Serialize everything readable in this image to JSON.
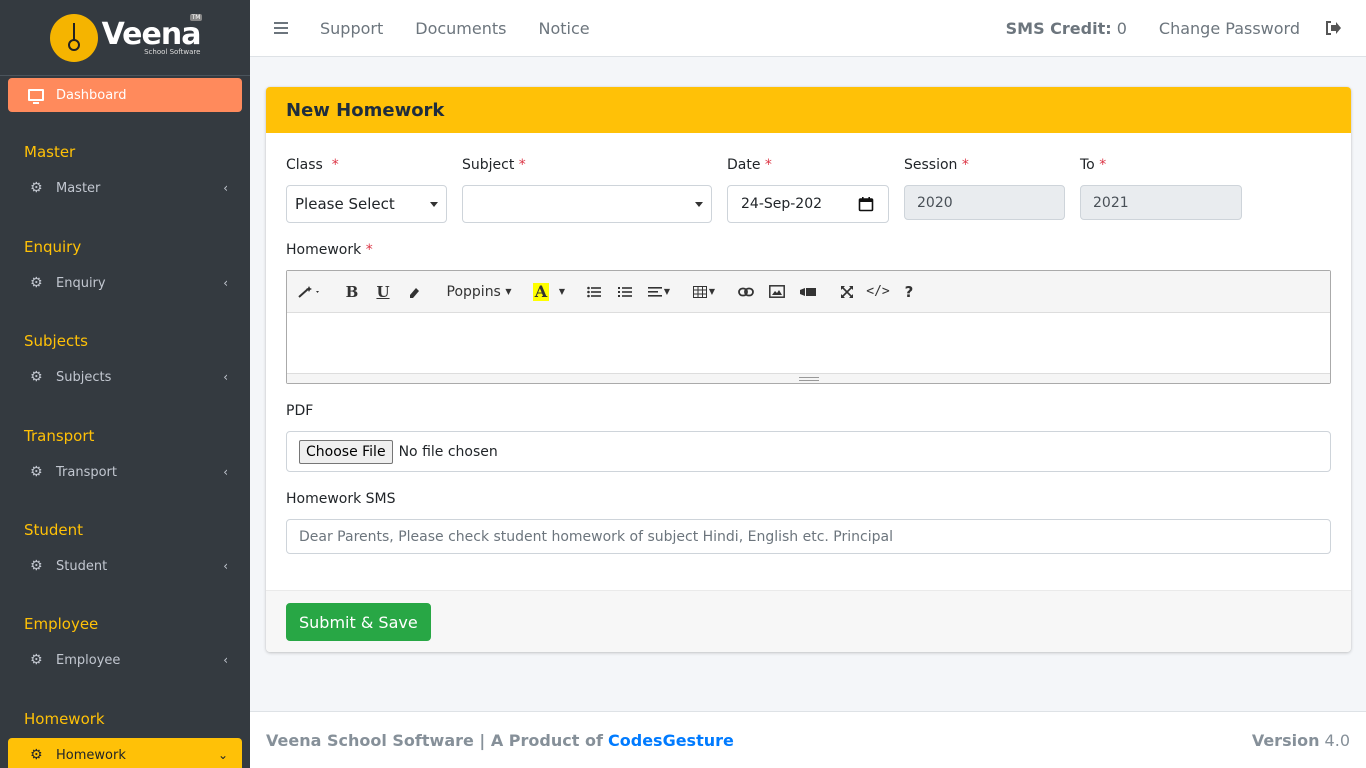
{
  "brand": {
    "name": "Veena",
    "subtitle": "School Software",
    "badge": "TM"
  },
  "sidebar": {
    "dashboard": "Dashboard",
    "sections": [
      {
        "header": "Master",
        "item": "Master"
      },
      {
        "header": "Enquiry",
        "item": "Enquiry"
      },
      {
        "header": "Subjects",
        "item": "Subjects"
      },
      {
        "header": "Transport",
        "item": "Transport"
      },
      {
        "header": "Student",
        "item": "Student"
      },
      {
        "header": "Employee",
        "item": "Employee"
      },
      {
        "header": "Homework",
        "item": "Homework"
      }
    ]
  },
  "topbar": {
    "links": [
      "Support",
      "Documents",
      "Notice"
    ],
    "sms_label": "SMS Credit:",
    "sms_value": "0",
    "change_password": "Change Password"
  },
  "form": {
    "title": "New Homework",
    "class_label": "Class",
    "class_value": "Please Select",
    "subject_label": "Subject",
    "subject_value": "",
    "date_label": "Date",
    "date_value": "24-Sep-202",
    "session_label": "Session",
    "session_value": "2020",
    "to_label": "To",
    "to_value": "2021",
    "required_mark": "*",
    "homework_label": "Homework",
    "editor_font": "Poppins",
    "pdf_label": "PDF",
    "file_button": "Choose File",
    "file_status": "No file chosen",
    "sms_label": "Homework SMS",
    "sms_placeholder": "Dear Parents, Please check student homework of subject Hindi, English etc. Principal",
    "submit": "Submit & Save"
  },
  "footer": {
    "text": "Veena School Software | A Product of",
    "company": "CodesGesture",
    "version_label": "Version",
    "version": "4.0"
  }
}
